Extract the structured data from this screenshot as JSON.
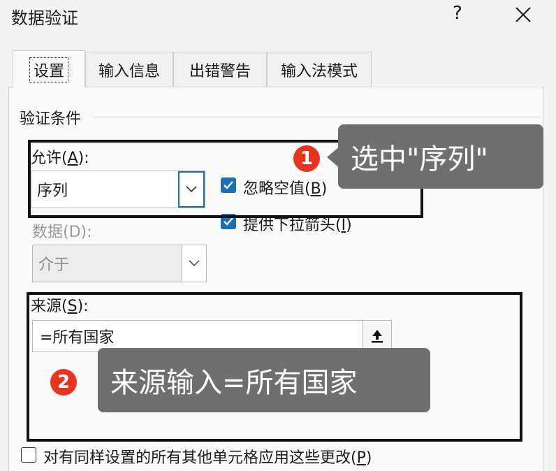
{
  "window": {
    "title": "数据验证",
    "help": "?",
    "close_icon": "close-icon"
  },
  "tabs": [
    {
      "label": "设置",
      "active": true
    },
    {
      "label": "输入信息",
      "active": false
    },
    {
      "label": "出错警告",
      "active": false
    },
    {
      "label": "输入法模式",
      "active": false
    }
  ],
  "section": {
    "title": "验证条件"
  },
  "allow": {
    "label_prefix": "允许(",
    "accel": "A",
    "label_suffix": "):",
    "value": "序列"
  },
  "data": {
    "label_prefix": "数据(",
    "accel": "D",
    "label_suffix": "):",
    "value": "介于"
  },
  "ignore_blank": {
    "label_prefix": "忽略空值(",
    "accel": "B",
    "label_suffix": ")",
    "checked": true
  },
  "dropdown_arrow": {
    "label_prefix": "提供下拉箭头(",
    "accel": "I",
    "label_suffix": ")",
    "checked": true
  },
  "source": {
    "label_prefix": "来源(",
    "accel": "S",
    "label_suffix": "):",
    "value": "=所有国家"
  },
  "apply_all": {
    "label_prefix": "对有同样设置的所有其他单元格应用这些更改(",
    "accel": "P",
    "label_suffix": ")",
    "checked": false
  },
  "annotations": [
    {
      "number": "1",
      "text": "选中\"序列\""
    },
    {
      "number": "2",
      "text": "来源输入=所有国家"
    }
  ],
  "colors": {
    "accent": "#1b6fb8",
    "badge": "#e8341c",
    "callout": "#6f6f6f"
  }
}
